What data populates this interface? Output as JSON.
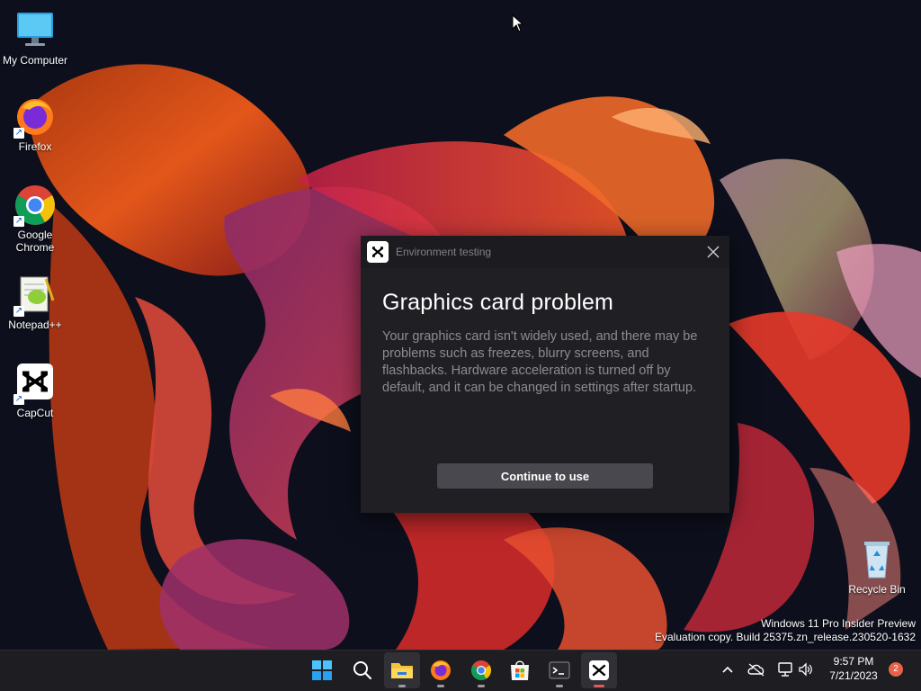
{
  "desktop": {
    "icons": [
      {
        "label": "My Computer",
        "icon": "monitor-icon"
      },
      {
        "label": "Firefox",
        "icon": "firefox-icon"
      },
      {
        "label": "Google Chrome",
        "icon": "chrome-icon"
      },
      {
        "label": "Notepad++",
        "icon": "notepad-plus-plus-icon"
      },
      {
        "label": "CapCut",
        "icon": "capcut-icon"
      },
      {
        "label": "Recycle Bin",
        "icon": "recycle-bin-icon"
      }
    ],
    "watermark": {
      "line1": "Windows 11 Pro Insider Preview",
      "line2": "Evaluation copy. Build 25375.zn_release.230520-1632"
    }
  },
  "dialog": {
    "window_title": "Environment testing",
    "heading": "Graphics card problem",
    "message": "Your graphics card isn't widely used, and there may be problems such as freezes, blurry screens, and flashbacks. Hardware acceleration is turned off by default, and it can be changed in settings after startup.",
    "button_label": "Continue to use",
    "close_icon": "close-icon"
  },
  "taskbar": {
    "apps": [
      "start-icon",
      "search-icon",
      "file-explorer-icon",
      "firefox-icon",
      "chrome-icon",
      "microsoft-store-icon",
      "terminal-icon",
      "capcut-icon"
    ],
    "clock": {
      "time": "9:57 PM",
      "date": "7/21/2023"
    },
    "notification_count": "2"
  },
  "colors": {
    "dialog_bg": "#202024",
    "button_bg": "#48484e",
    "accent_ribbon": "#e8421c"
  }
}
